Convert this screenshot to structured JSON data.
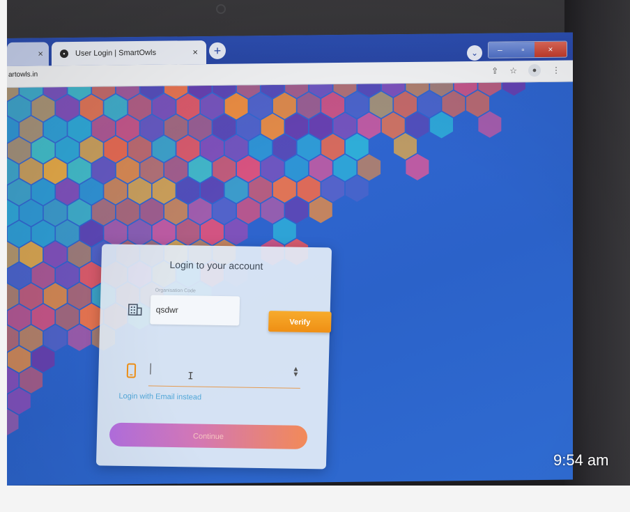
{
  "browser": {
    "prev_tab_close": "×",
    "active_tab": {
      "title": "User Login | SmartOwls",
      "close": "×"
    },
    "new_tab": "+",
    "tab_search": "⌄",
    "window_controls": {
      "minimize": "–",
      "maximize": "▫",
      "close": "×"
    },
    "url": "artowls.in",
    "toolbar_icons": [
      "share-icon",
      "star-icon",
      "profile-icon",
      "menu-icon"
    ]
  },
  "login": {
    "title": "Login to your account",
    "org_code_label": "Organisation Code",
    "org_code_value": "qsdwr",
    "verify_label": "Verify",
    "email_link": "Login with Email instead",
    "continue_label": "Continue"
  },
  "overlay": {
    "time": "9:54 am"
  },
  "colors": {
    "accent_orange": "#ef8f14",
    "link_blue": "#52a7d8",
    "background_blue": "#2f65cf",
    "continue_gradient_start": "#b36fe0",
    "continue_gradient_end": "#f28a58"
  }
}
